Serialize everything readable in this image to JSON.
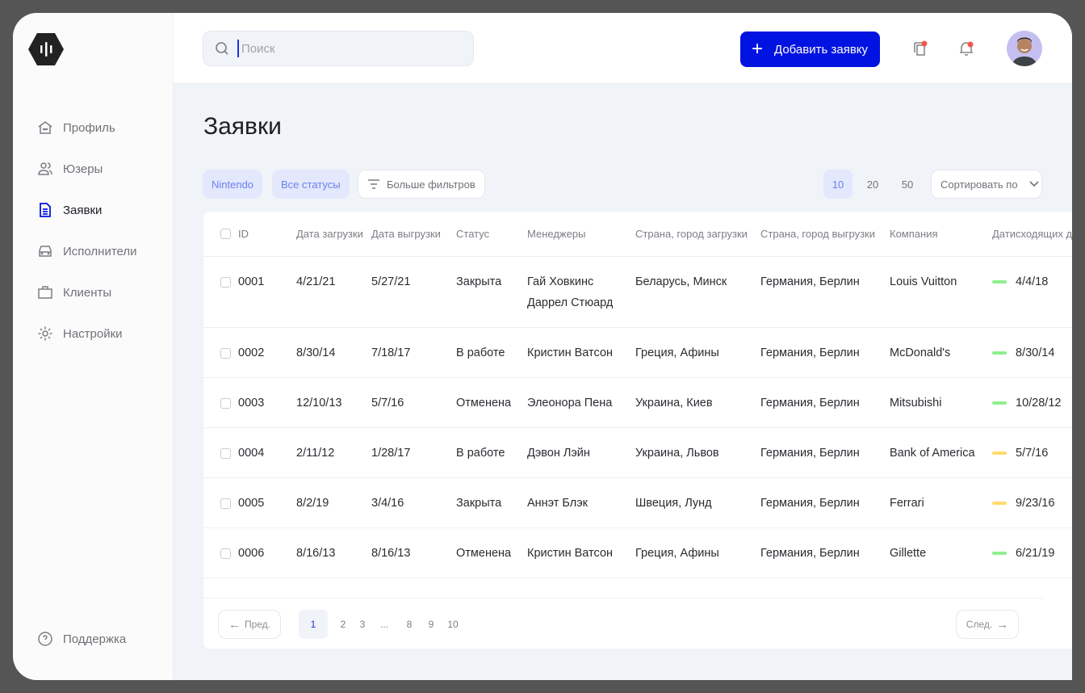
{
  "sidebar": {
    "items": [
      {
        "label": "Профиль",
        "icon": "home-icon"
      },
      {
        "label": "Юзеры",
        "icon": "users-icon"
      },
      {
        "label": "Заявки",
        "icon": "document-icon"
      },
      {
        "label": "Исполнители",
        "icon": "car-icon"
      },
      {
        "label": "Клиенты",
        "icon": "briefcase-icon"
      },
      {
        "label": "Настройки",
        "icon": "gear-icon"
      }
    ],
    "active": "Заявки",
    "support": "Поддержка"
  },
  "header": {
    "search_placeholder": "Поиск",
    "add_button": "Добавить заявку"
  },
  "page": {
    "title": "Заявки"
  },
  "filters": {
    "chips": [
      "Nintendo",
      "Все статусы"
    ],
    "more": "Больше фильтров",
    "per_page": [
      "10",
      "20",
      "50"
    ],
    "per_page_selected": "10",
    "sort": "Сортировать по"
  },
  "table": {
    "columns": [
      "ID",
      "Дата загрузки",
      "Дата выгрузки",
      "Статус",
      "Менеджеры",
      "Страна, город загрузки",
      "Страна, город выгрузки",
      "Компания",
      "Датисходящих д"
    ],
    "rows": [
      {
        "id": "0001",
        "load": "4/21/21",
        "unload": "5/27/21",
        "status": "Закрыта",
        "m1": "Гай Ховкинс",
        "m2": "Даррел Стюард",
        "from": "Беларусь, Минск",
        "to": "Германия, Берлин",
        "company": "Louis Vuitton",
        "date": "4/4/18",
        "indicator": "#8ef08e"
      },
      {
        "id": "0002",
        "load": "8/30/14",
        "unload": "7/18/17",
        "status": "В работе",
        "m1": "Кристин Ватсон",
        "from": "Греция, Афины",
        "to": "Германия, Берлин",
        "company": "McDonald's",
        "date": "8/30/14",
        "indicator": "#8ef08e"
      },
      {
        "id": "0003",
        "load": "12/10/13",
        "unload": "5/7/16",
        "status": "Отменена",
        "m1": "Элеонора Пена",
        "from": "Украина, Киев",
        "to": "Германия, Берлин",
        "company": "Mitsubishi",
        "date": "10/28/12",
        "indicator": "#8ef08e"
      },
      {
        "id": "0004",
        "load": "2/11/12",
        "unload": "1/28/17",
        "status": "В работе",
        "m1": "Дэвон Лэйн",
        "from": "Украина, Львов",
        "to": "Германия, Берлин",
        "company": "Bank of America",
        "date": "5/7/16",
        "indicator": "#ffdb6b"
      },
      {
        "id": "0005",
        "load": "8/2/19",
        "unload": "3/4/16",
        "status": "Закрыта",
        "m1": "Аннэт Блэк",
        "from": "Швеция, Лунд",
        "to": "Германия, Берлин",
        "company": "Ferrari",
        "date": "9/23/16",
        "indicator": "#ffdb6b"
      },
      {
        "id": "0006",
        "load": "8/16/13",
        "unload": "8/16/13",
        "status": "Отменена",
        "m1": "Кристин Ватсон",
        "from": "Греция, Афины",
        "to": "Германия, Берлин",
        "company": "Gillette",
        "date": "6/21/19",
        "indicator": "#8ef08e"
      }
    ]
  },
  "pagination": {
    "prev": "Пред.",
    "next": "След.",
    "pages": [
      "1",
      "2",
      "3",
      "...",
      "8",
      "9",
      "10"
    ],
    "current": "1"
  }
}
